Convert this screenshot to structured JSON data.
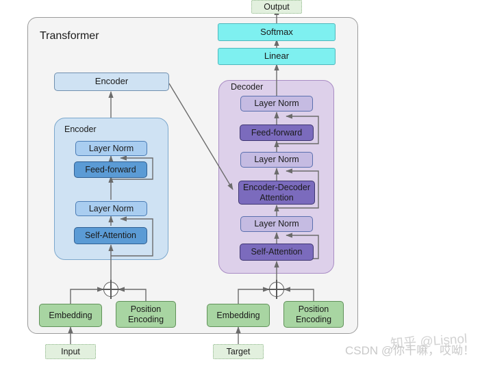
{
  "diagram": {
    "title": "Transformer",
    "outer_container_label": "Transformer",
    "encoder_stack_label": "Encoder",
    "decoder_stack_label": "Decoder"
  },
  "top": {
    "output_label": "Output",
    "softmax_label": "Softmax",
    "linear_label": "Linear"
  },
  "encoder_summary": {
    "label": "Encoder"
  },
  "encoder_stack": {
    "label": "Encoder",
    "layers": [
      {
        "label": "Layer Norm"
      },
      {
        "label": "Feed-forward"
      },
      {
        "label": "Layer Norm"
      },
      {
        "label": "Self-Attention"
      }
    ]
  },
  "decoder_stack": {
    "label": "Decoder",
    "layers": [
      {
        "label": "Layer Norm"
      },
      {
        "label": "Feed-forward"
      },
      {
        "label": "Layer Norm"
      },
      {
        "label": "Encoder-Decoder Attention"
      },
      {
        "label": "Layer Norm"
      },
      {
        "label": "Self-Attention"
      }
    ],
    "enc_dec_attention_line1": "Encoder-Decoder",
    "enc_dec_attention_line2": "Attention"
  },
  "inputs": {
    "source": {
      "io_label": "Input",
      "embedding_label": "Embedding",
      "position_encoding_line1": "Position",
      "position_encoding_line2": "Encoding",
      "sum_operator": "plus-circle"
    },
    "target": {
      "io_label": "Target",
      "embedding_label": "Embedding",
      "position_encoding_line1": "Position",
      "position_encoding_line2": "Encoding",
      "sum_operator": "plus-circle"
    }
  },
  "watermarks": {
    "csdn": "CSDN @你干嘛，哎呦！",
    "zhihu": "知乎 @Lisnol"
  },
  "colors": {
    "canvas_background": "#ffffff",
    "outer_container_fill": "#f4f4f4",
    "outer_container_stroke": "#9a9a9a",
    "encoder_container_fill": "#cfe2f3",
    "decoder_container_fill": "#ddd0ea",
    "cyan_block": "#7ef0f0",
    "encoder_layernorm": "#a9cdf0",
    "encoder_attention": "#5b9bd5",
    "decoder_layernorm": "#c5bbe2",
    "decoder_attention": "#7b6bbd",
    "green_block": "#a8d5a2",
    "io_block": "#e2f0de",
    "arrow_stroke": "#6b6b6b"
  }
}
